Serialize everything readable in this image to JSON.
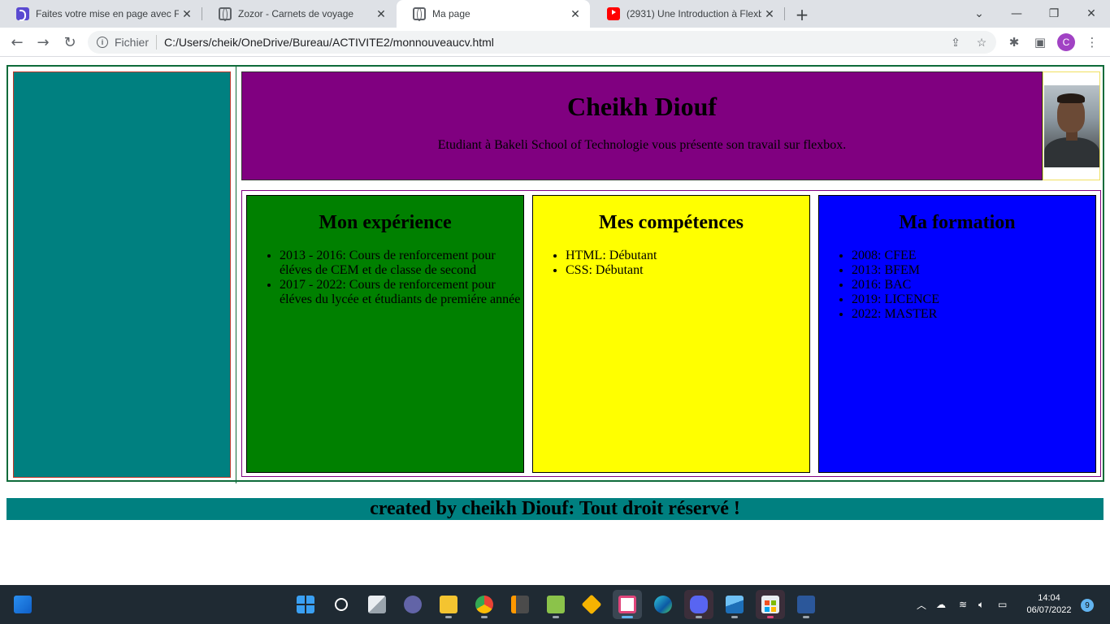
{
  "browser": {
    "tabs": [
      {
        "title": "Faites votre mise en page avec Fl",
        "icon": "document-icon"
      },
      {
        "title": "Zozor - Carnets de voyage",
        "icon": "globe-icon"
      },
      {
        "title": "Ma page",
        "icon": "globe-icon"
      },
      {
        "title": "(2931) Une Introduction à Flexbo",
        "icon": "youtube-icon"
      }
    ],
    "address": {
      "scheme": "Fichier",
      "url": "C:/Users/cheik/OneDrive/Bureau/ACTIVITE2/monnouveaucv.html"
    },
    "profile_initial": "C"
  },
  "page": {
    "header": {
      "name": "Cheikh Diouf",
      "subtitle": "Etudiant à Bakeli School of Technologie vous présente son travail sur flexbox."
    },
    "sections": {
      "experience": {
        "title": "Mon expérience",
        "items": [
          "2013 - 2016: Cours de renforcement pour éléves de CEM et de classe de second",
          "2017 - 2022: Cours de renforcement pour éléves du lycée et étudiants de premiére année"
        ]
      },
      "skills": {
        "title": "Mes compétences",
        "items": [
          "HTML: Débutant",
          "CSS: Débutant"
        ]
      },
      "education": {
        "title": "Ma formation",
        "items": [
          "2008: CFEE",
          "2013: BFEM",
          "2016: BAC",
          "2019: LICENCE",
          "2022: MASTER"
        ]
      }
    },
    "footer": "created by cheikh Diouf: Tout droit réservé !",
    "colors": {
      "sidebar": "#008080",
      "header": "#800080",
      "experience": "#008000",
      "skills": "#ffff00",
      "education": "#0000ff",
      "footer": "#008080"
    }
  },
  "taskbar": {
    "time": "14:04",
    "date": "06/07/2022",
    "notification_count": "9"
  }
}
